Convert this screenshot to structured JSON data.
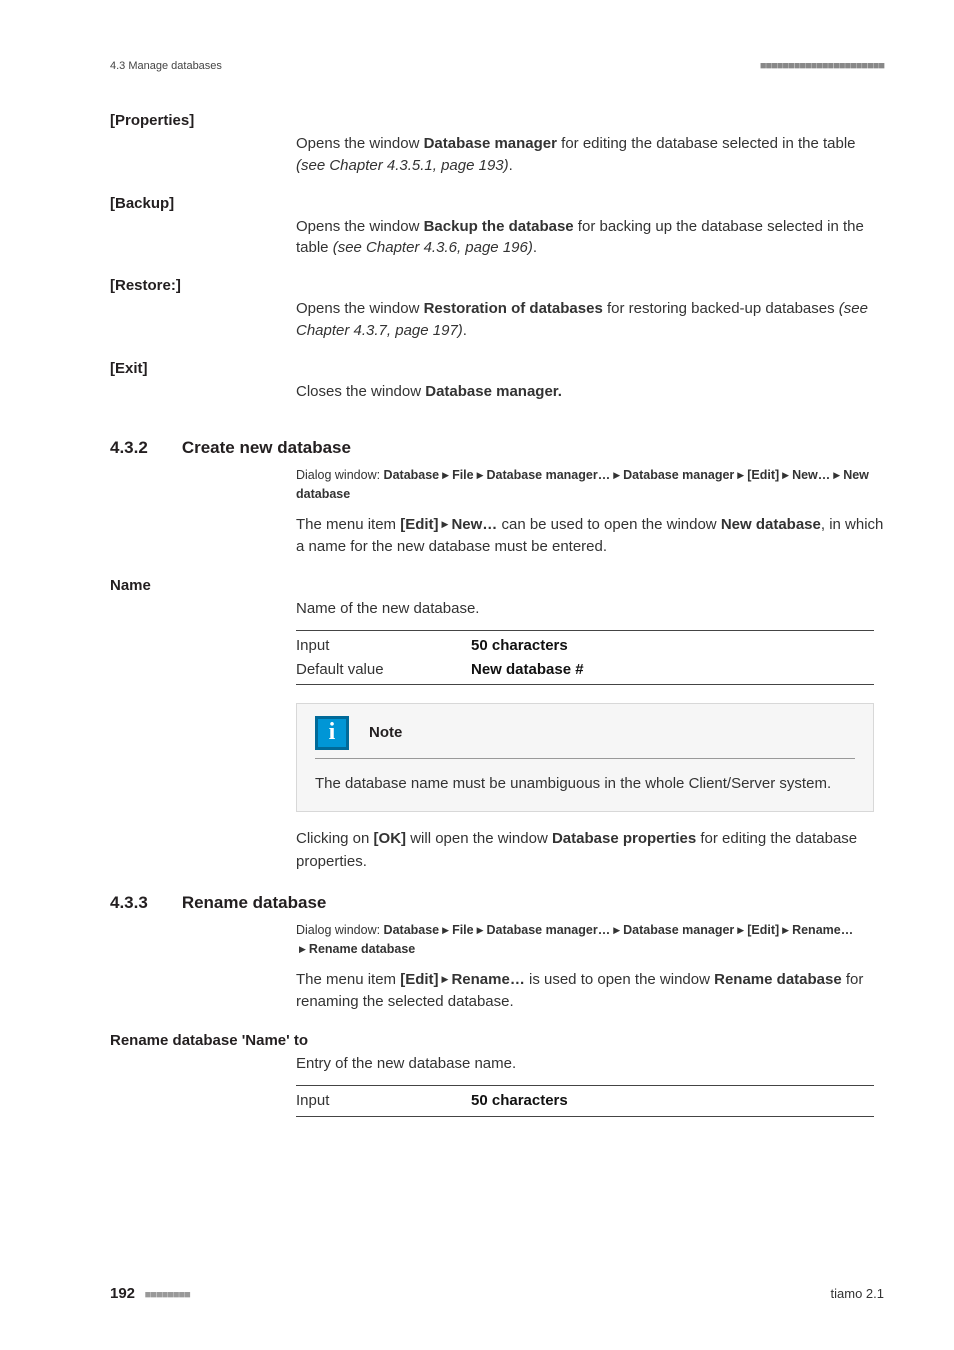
{
  "header": {
    "left": "4.3 Manage databases",
    "dots": "■■■■■■■■■■■■■■■■■■■■■■"
  },
  "defs": [
    {
      "term": "[Properties]",
      "body_pre": "Opens the window ",
      "body_bold": "Database manager",
      "body_post": " for editing the database selected in the table ",
      "body_ital": "(see Chapter 4.3.5.1, page 193)",
      "body_end": "."
    },
    {
      "term": "[Backup]",
      "body_pre": "Opens the window ",
      "body_bold": "Backup the database",
      "body_post": " for backing up the database selected in the table ",
      "body_ital": "(see Chapter 4.3.6, page 196)",
      "body_end": "."
    },
    {
      "term": "[Restore:]",
      "body_pre": "Opens the window ",
      "body_bold": "Restoration of databases",
      "body_post": " for restoring backed-up databases ",
      "body_ital": "(see Chapter 4.3.7, page 197)",
      "body_end": "."
    },
    {
      "term": "[Exit]",
      "body_pre": "Closes the window ",
      "body_bold": "Database manager.",
      "body_post": "",
      "body_ital": "",
      "body_end": ""
    }
  ],
  "section432": {
    "num": "4.3.2",
    "title": "Create new database",
    "bc_prefix": "Dialog window: ",
    "bc_parts": [
      "Database",
      "File",
      "Database manager…",
      "Database manager",
      "[Edit]",
      "New…",
      "New database"
    ],
    "p1_a": "The menu item ",
    "p1_b": "[Edit]",
    "p1_c": "New…",
    "p1_d": " can be used to open the window ",
    "p1_e": "New database",
    "p1_f": ", in which a name for the new database must be entered.",
    "name_label": "Name",
    "name_desc": "Name of the new database.",
    "row1_l": "Input",
    "row1_v": "50 characters",
    "row2_l": "Default value",
    "row2_v": "New database #",
    "note_title": "Note",
    "note_body": "The database name must be unambiguous in the whole Client/Server system.",
    "p2_a": "Clicking on ",
    "p2_b": "[OK]",
    "p2_c": " will open the window ",
    "p2_d": "Database properties",
    "p2_e": " for editing the database properties."
  },
  "section433": {
    "num": "4.3.3",
    "title": "Rename database",
    "bc_prefix": "Dialog window: ",
    "bc_parts": [
      "Database",
      "File",
      "Database manager…",
      "Database manager",
      "[Edit]",
      "Rename…",
      "Rename database"
    ],
    "p1_a": "The menu item ",
    "p1_b": "[Edit]",
    "p1_c": "Rename…",
    "p1_d": " is used to open the window ",
    "p1_e": "Rename database",
    "p1_f": " for renaming the selected database.",
    "rename_label": "Rename database 'Name' to",
    "rename_desc": "Entry of the new database name.",
    "row1_l": "Input",
    "row1_v": "50 characters"
  },
  "footer": {
    "page": "192",
    "dots": "■■■■■■■■",
    "product": "tiamo 2.1"
  }
}
